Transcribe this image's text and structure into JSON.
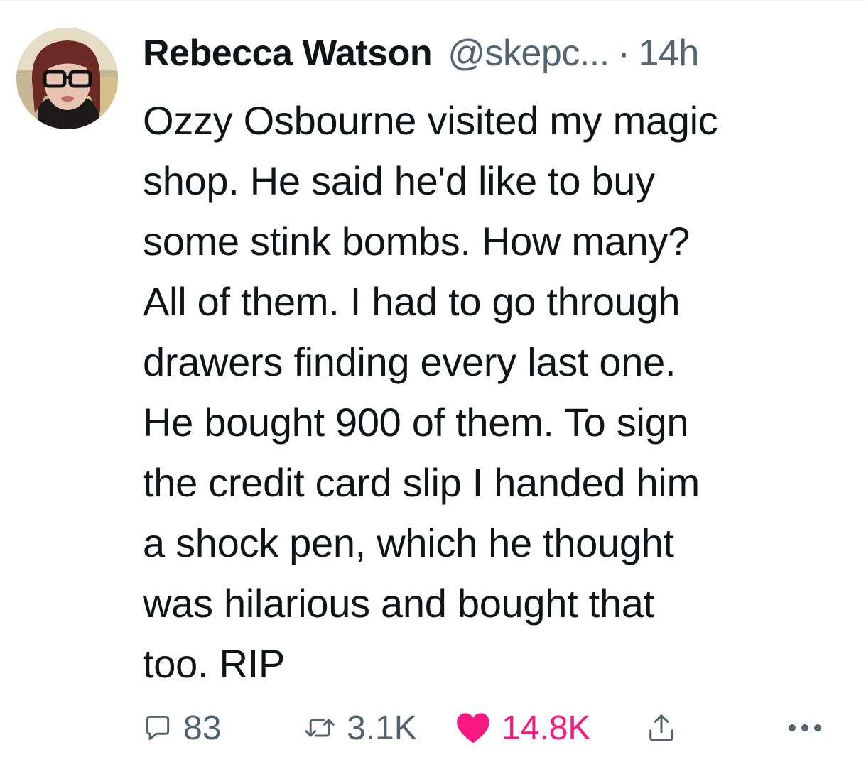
{
  "tweet": {
    "author": {
      "display_name": "Rebecca Watson",
      "handle": "@skepc...",
      "separator": "·",
      "timestamp": "14h"
    },
    "text_lines": [
      "Ozzy Osbourne visited my magic",
      "shop. He said he'd like to buy",
      "some stink bombs. How many?",
      "All of them. I had to go through",
      "drawers finding every last one.",
      "He bought 900 of them. To sign",
      "the credit card slip I handed him",
      "a shock pen, which he thought",
      "was hilarious and bought that",
      "too. RIP"
    ],
    "actions": {
      "replies": {
        "icon": "reply-icon",
        "count": "83"
      },
      "retweets": {
        "icon": "retweet-icon",
        "count": "3.1K"
      },
      "likes": {
        "icon": "heart-icon",
        "count": "14.8K",
        "liked": true
      },
      "share": {
        "icon": "share-icon"
      },
      "more": {
        "icon": "more-icon"
      }
    },
    "colors": {
      "text": "#0f1419",
      "secondary": "#536471",
      "like_active": "#f91880"
    }
  }
}
